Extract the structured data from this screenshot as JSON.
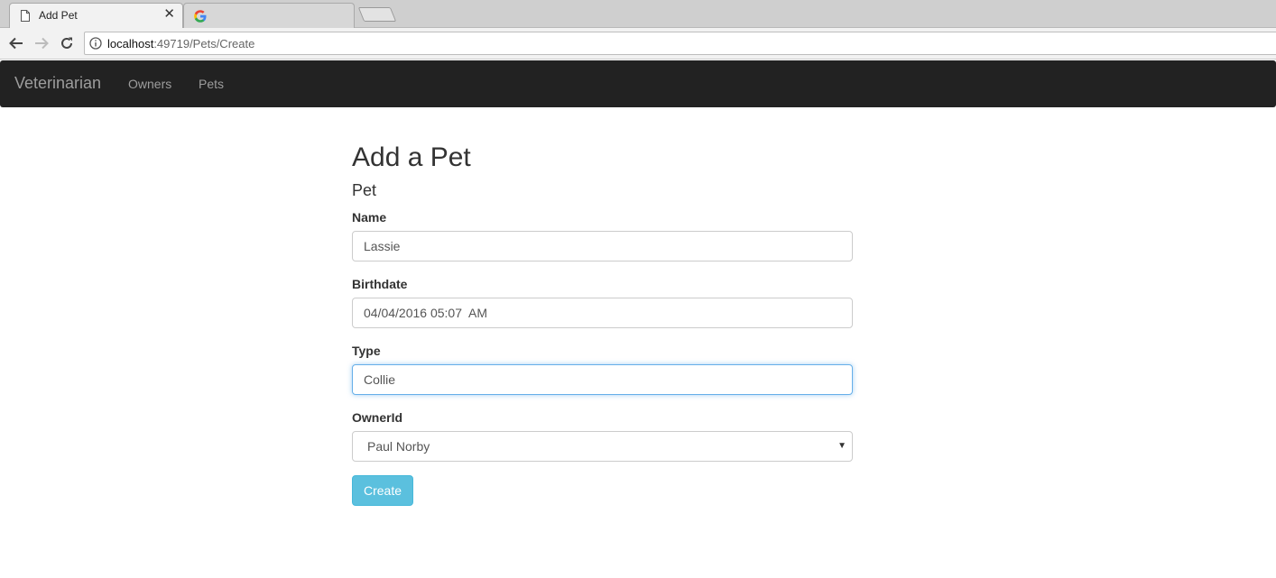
{
  "browser": {
    "active_tab": {
      "title": "Add Pet",
      "close_glyph": "✕",
      "icon": "page-icon"
    },
    "inactive_tab": {
      "icon": "google-icon"
    },
    "address": {
      "host": "localhost",
      "rest": ":49719/Pets/Create"
    }
  },
  "navbar": {
    "brand": "Veterinarian",
    "links": [
      "Owners",
      "Pets"
    ]
  },
  "page": {
    "title": "Add a Pet",
    "subtitle": "Pet"
  },
  "form": {
    "name": {
      "label": "Name",
      "value": "Lassie"
    },
    "birthdate": {
      "label": "Birthdate",
      "value": "04/04/2016 05:07  AM"
    },
    "type": {
      "label": "Type",
      "value": "Collie"
    },
    "owner": {
      "label": "OwnerId",
      "value": "Paul Norby",
      "caret": "▼"
    },
    "submit_label": "Create"
  },
  "colors": {
    "navbar_bg": "#222222",
    "button_bg": "#5bc0de",
    "focus_border": "#66afe9"
  }
}
